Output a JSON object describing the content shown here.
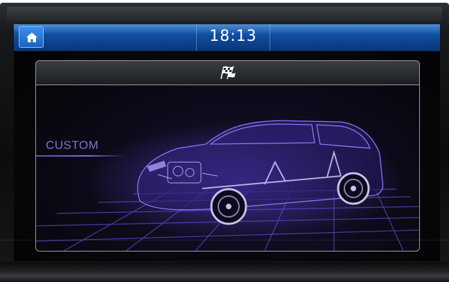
{
  "status_bar": {
    "time": "18:13",
    "home_icon": "home-icon"
  },
  "drive_mode": {
    "header_icon": "checkered-flag-icon",
    "mode_label": "CUSTOM",
    "illustration": "car-xray-illustration"
  },
  "colors": {
    "status_bar_blue": "#0f4d9e",
    "home_button_blue": "#1a64c1",
    "mode_label_purple": "#7f73c7",
    "car_glow_purple": "#6a4cff"
  }
}
